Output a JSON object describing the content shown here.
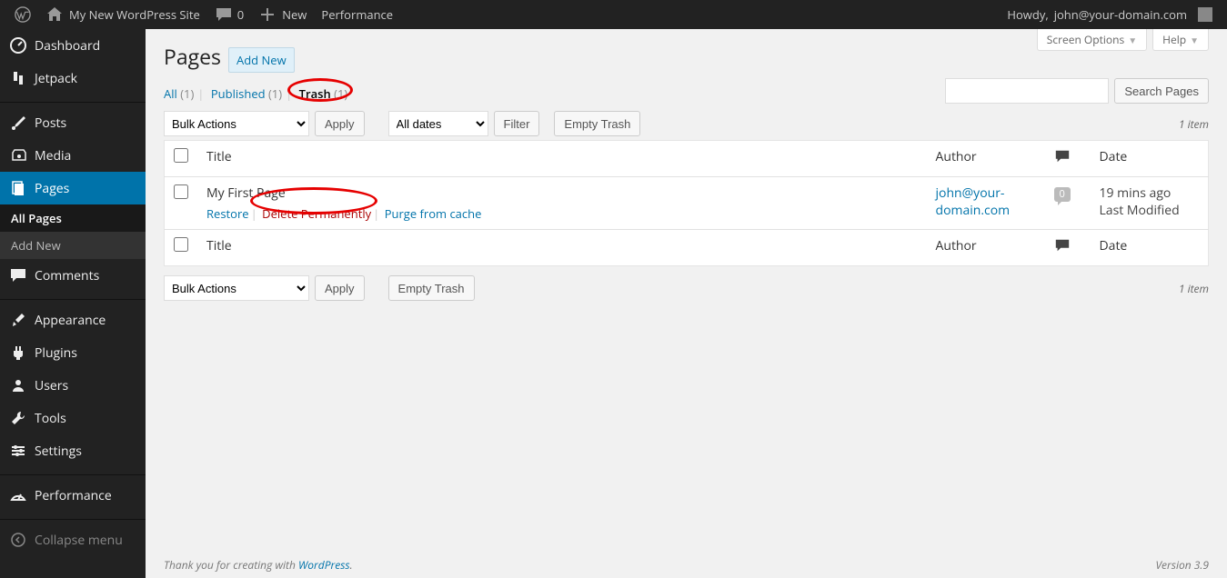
{
  "adminbar": {
    "site_name": "My New WordPress Site",
    "comments_count": "0",
    "new_label": "New",
    "performance_label": "Performance",
    "howdy_prefix": "Howdy, ",
    "user": "john@your-domain.com"
  },
  "sidebar": {
    "items": [
      {
        "label": "Dashboard",
        "icon": "dashboard"
      },
      {
        "label": "Jetpack",
        "icon": "jetpack"
      },
      {
        "label": "Posts",
        "icon": "pin"
      },
      {
        "label": "Media",
        "icon": "media"
      },
      {
        "label": "Pages",
        "icon": "page",
        "current": true
      },
      {
        "label": "Comments",
        "icon": "comment"
      },
      {
        "label": "Appearance",
        "icon": "brush"
      },
      {
        "label": "Plugins",
        "icon": "plug"
      },
      {
        "label": "Users",
        "icon": "user"
      },
      {
        "label": "Tools",
        "icon": "wrench"
      },
      {
        "label": "Settings",
        "icon": "settings"
      },
      {
        "label": "Performance",
        "icon": "performance"
      }
    ],
    "submenu": [
      {
        "label": "All Pages",
        "current": true
      },
      {
        "label": "Add New"
      }
    ],
    "collapse": "Collapse menu"
  },
  "screen_options": "Screen Options",
  "help": "Help",
  "page_heading": "Pages",
  "add_new": "Add New",
  "filters": {
    "all": {
      "label": "All",
      "count": "(1)"
    },
    "published": {
      "label": "Published",
      "count": "(1)"
    },
    "trash": {
      "label": "Trash",
      "count": "(1)"
    }
  },
  "search": {
    "button": "Search Pages"
  },
  "bulk_actions": "Bulk Actions",
  "apply": "Apply",
  "all_dates": "All dates",
  "filter": "Filter",
  "empty_trash": "Empty Trash",
  "item_count": "1 item",
  "columns": {
    "title": "Title",
    "author": "Author",
    "date": "Date"
  },
  "rows": [
    {
      "title": "My First Page",
      "actions": {
        "restore": "Restore",
        "delete": "Delete Permanently",
        "purge": "Purge from cache"
      },
      "author": "john@your-domain.com",
      "comment_count": "0",
      "date_line1": "19 mins ago",
      "date_line2": "Last Modified"
    }
  ],
  "footer": {
    "thankyou": "Thank you for creating with ",
    "wordpress": "WordPress",
    "version": "Version 3.9"
  }
}
